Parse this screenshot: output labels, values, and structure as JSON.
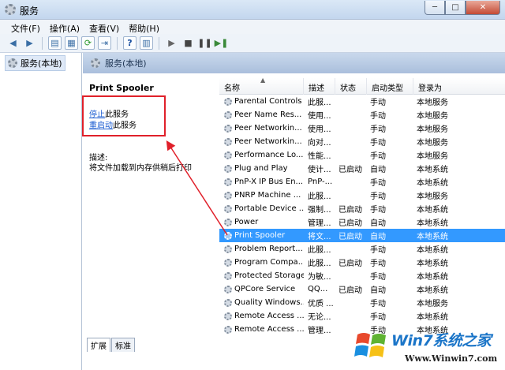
{
  "window": {
    "title": "服务",
    "buttons": {
      "minimize": "─",
      "maximize": "□",
      "close": "✕"
    }
  },
  "menubar": [
    {
      "label": "文件(F)"
    },
    {
      "label": "操作(A)"
    },
    {
      "label": "查看(V)"
    },
    {
      "label": "帮助(H)"
    }
  ],
  "tree": {
    "root": "服务(本地)"
  },
  "panel": {
    "header": "服务(本地)",
    "service_name": "Print Spooler",
    "stop_link": "停止",
    "stop_suffix": "此服务",
    "restart_link": "重启动",
    "restart_suffix": "此服务",
    "desc_label": "描述:",
    "desc_text": "将文件加载到内存供稍后打印"
  },
  "list": {
    "columns": [
      "名称",
      "描述",
      "状态",
      "启动类型",
      "登录为"
    ],
    "rows": [
      {
        "name": "Parental Controls",
        "desc": "此服...",
        "status": "",
        "startup": "手动",
        "logon": "本地服务"
      },
      {
        "name": "Peer Name Res...",
        "desc": "使用...",
        "status": "",
        "startup": "手动",
        "logon": "本地服务"
      },
      {
        "name": "Peer Networkin...",
        "desc": "使用...",
        "status": "",
        "startup": "手动",
        "logon": "本地服务"
      },
      {
        "name": "Peer Networkin...",
        "desc": "向对...",
        "status": "",
        "startup": "手动",
        "logon": "本地服务"
      },
      {
        "name": "Performance Lo...",
        "desc": "性能...",
        "status": "",
        "startup": "手动",
        "logon": "本地服务"
      },
      {
        "name": "Plug and Play",
        "desc": "使计...",
        "status": "已启动",
        "startup": "自动",
        "logon": "本地系统"
      },
      {
        "name": "PnP-X IP Bus En...",
        "desc": "PnP-...",
        "status": "",
        "startup": "手动",
        "logon": "本地系统"
      },
      {
        "name": "PNRP Machine ...",
        "desc": "此服...",
        "status": "",
        "startup": "手动",
        "logon": "本地服务"
      },
      {
        "name": "Portable Device ...",
        "desc": "强制...",
        "status": "已启动",
        "startup": "手动",
        "logon": "本地系统"
      },
      {
        "name": "Power",
        "desc": "管理...",
        "status": "已启动",
        "startup": "自动",
        "logon": "本地系统"
      },
      {
        "name": "Print Spooler",
        "desc": "将文...",
        "status": "已启动",
        "startup": "自动",
        "logon": "本地系统",
        "selected": true
      },
      {
        "name": "Problem Report...",
        "desc": "此服...",
        "status": "",
        "startup": "手动",
        "logon": "本地系统"
      },
      {
        "name": "Program Compa...",
        "desc": "此服...",
        "status": "已启动",
        "startup": "手动",
        "logon": "本地系统"
      },
      {
        "name": "Protected Storage",
        "desc": "为敏...",
        "status": "",
        "startup": "手动",
        "logon": "本地系统"
      },
      {
        "name": "QPCore Service",
        "desc": "QQ...",
        "status": "已启动",
        "startup": "自动",
        "logon": "本地系统"
      },
      {
        "name": "Quality Windows...",
        "desc": "优质 ...",
        "status": "",
        "startup": "手动",
        "logon": "本地服务"
      },
      {
        "name": "Remote Access ...",
        "desc": "无论...",
        "status": "",
        "startup": "手动",
        "logon": "本地系统"
      },
      {
        "name": "Remote Access ...",
        "desc": "管理...",
        "status": "",
        "startup": "手动",
        "logon": "本地系统"
      }
    ]
  },
  "tabs": [
    {
      "label": "扩展",
      "active": true
    },
    {
      "label": "标准",
      "active": false
    }
  ],
  "watermark": {
    "brand": "Win7系统之家",
    "url": "Www.Winwin7.com"
  },
  "colors": {
    "selection": "#3399ff",
    "annotation": "#e0202a",
    "link": "#1a5bd0"
  }
}
